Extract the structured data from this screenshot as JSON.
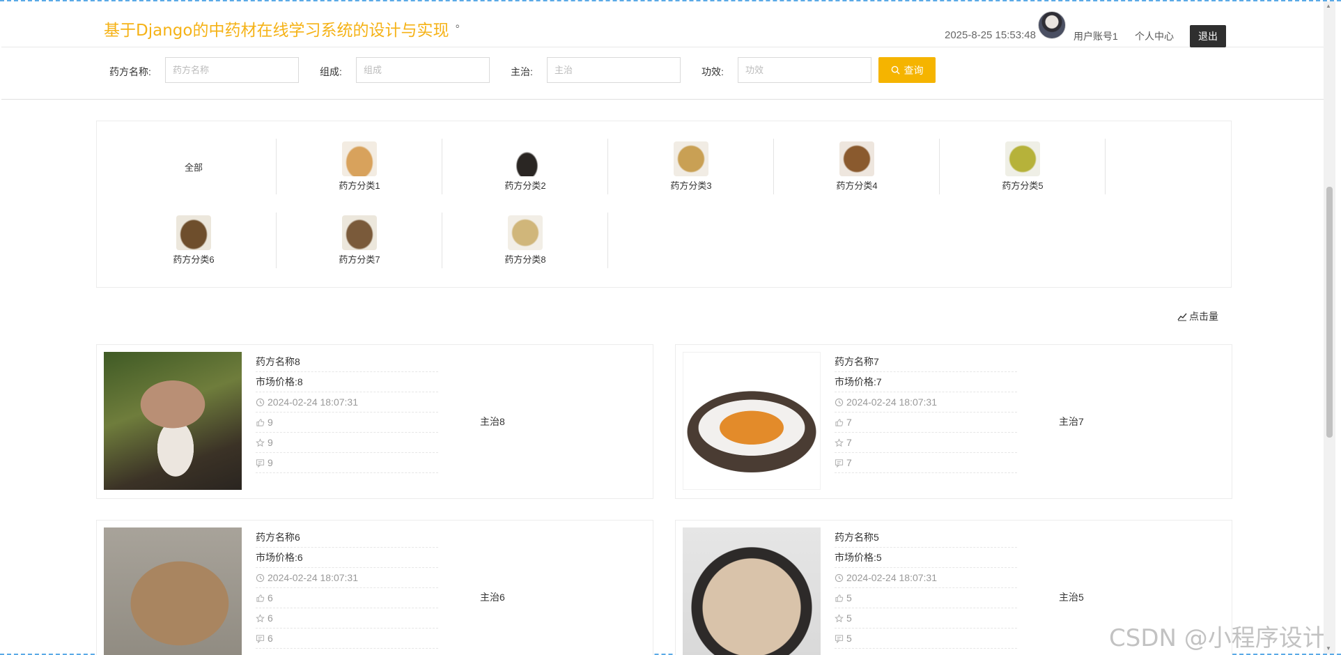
{
  "header": {
    "title": "基于Django的中药材在线学习系统的设计与实现",
    "dot": "。",
    "datetime": "2025-8-25 15:53:48",
    "account": "用户账号1",
    "profile": "个人中心",
    "logout": "退出"
  },
  "search": {
    "fields": [
      {
        "label": "药方名称:",
        "placeholder": "药方名称"
      },
      {
        "label": "组成:",
        "placeholder": "组成"
      },
      {
        "label": "主治:",
        "placeholder": "主治"
      },
      {
        "label": "功效:",
        "placeholder": "功效"
      }
    ],
    "button": "查询"
  },
  "categories": [
    {
      "label": "全部"
    },
    {
      "label": "药方分类1"
    },
    {
      "label": "药方分类2"
    },
    {
      "label": "药方分类3"
    },
    {
      "label": "药方分类4"
    },
    {
      "label": "药方分类5"
    },
    {
      "label": "药方分类6"
    },
    {
      "label": "药方分类7"
    },
    {
      "label": "药方分类8"
    }
  ],
  "sort_label": "点击量",
  "cards": [
    {
      "name": "药方名称8",
      "price": "市场价格:8",
      "date": "2024-02-24 18:07:31",
      "likes": "9",
      "favorites": "9",
      "comments": "9",
      "zhuzhi": "主治8"
    },
    {
      "name": "药方名称7",
      "price": "市场价格:7",
      "date": "2024-02-24 18:07:31",
      "likes": "7",
      "favorites": "7",
      "comments": "7",
      "zhuzhi": "主治7"
    },
    {
      "name": "药方名称6",
      "price": "市场价格:6",
      "date": "2024-02-24 18:07:31",
      "likes": "6",
      "favorites": "6",
      "comments": "6",
      "zhuzhi": "主治6"
    },
    {
      "name": "药方名称5",
      "price": "市场价格:5",
      "date": "2024-02-24 18:07:31",
      "likes": "5",
      "favorites": "5",
      "comments": "5",
      "zhuzhi": "主治5"
    }
  ],
  "watermark": "CSDN @小程序设计",
  "colors": {
    "brand": "#f5b216",
    "button": "#f5b400",
    "logout": "#2f2f2f"
  }
}
